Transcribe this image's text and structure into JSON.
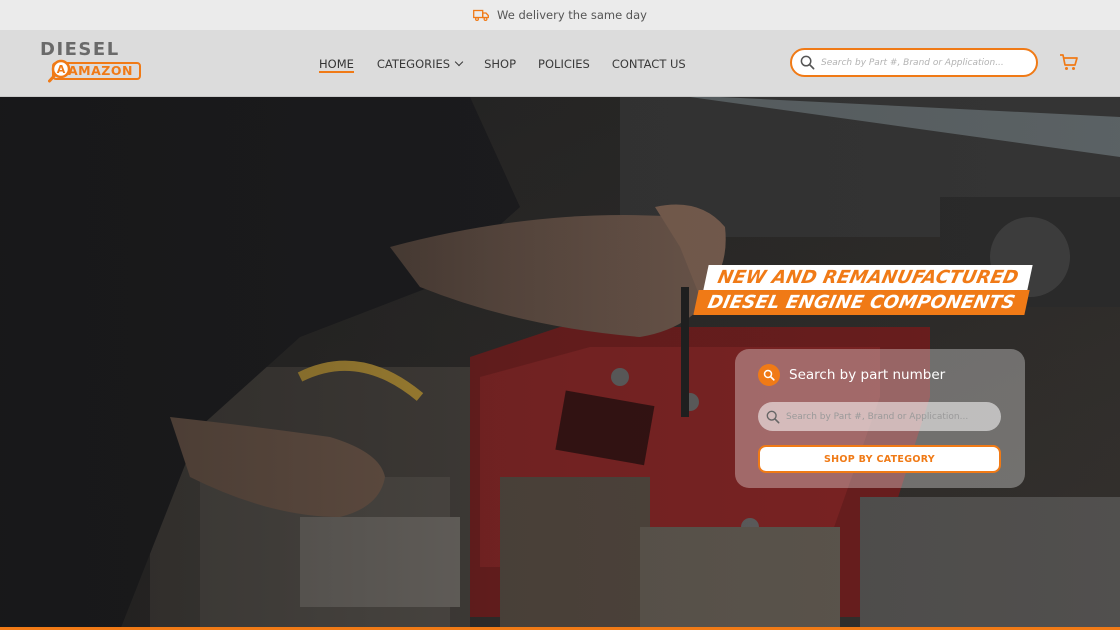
{
  "announcement": {
    "text": "We delivery the same day",
    "icon": "truck-icon"
  },
  "logo": {
    "line1": "DIESEL",
    "line2": "AMAZON"
  },
  "nav": {
    "items": [
      {
        "label": "HOME",
        "active": true
      },
      {
        "label": "CATEGORIES",
        "has_dropdown": true
      },
      {
        "label": "SHOP"
      },
      {
        "label": "POLICIES"
      },
      {
        "label": "CONTACT US"
      }
    ]
  },
  "header_search": {
    "placeholder": "Search by Part #, Brand or Application..."
  },
  "cart": {
    "icon": "cart-icon"
  },
  "hero": {
    "headline_line1": "NEW AND REMANUFACTURED",
    "headline_line2": "DIESEL ENGINE COMPONENTS",
    "card": {
      "title": "Search by part number",
      "search_placeholder": "Search by Part #, Brand or Application...",
      "button_label": "SHOP BY CATEGORY"
    }
  },
  "colors": {
    "accent": "#f07a16",
    "header_bg": "#dcdcdc",
    "topbar_bg": "#ebebeb"
  }
}
